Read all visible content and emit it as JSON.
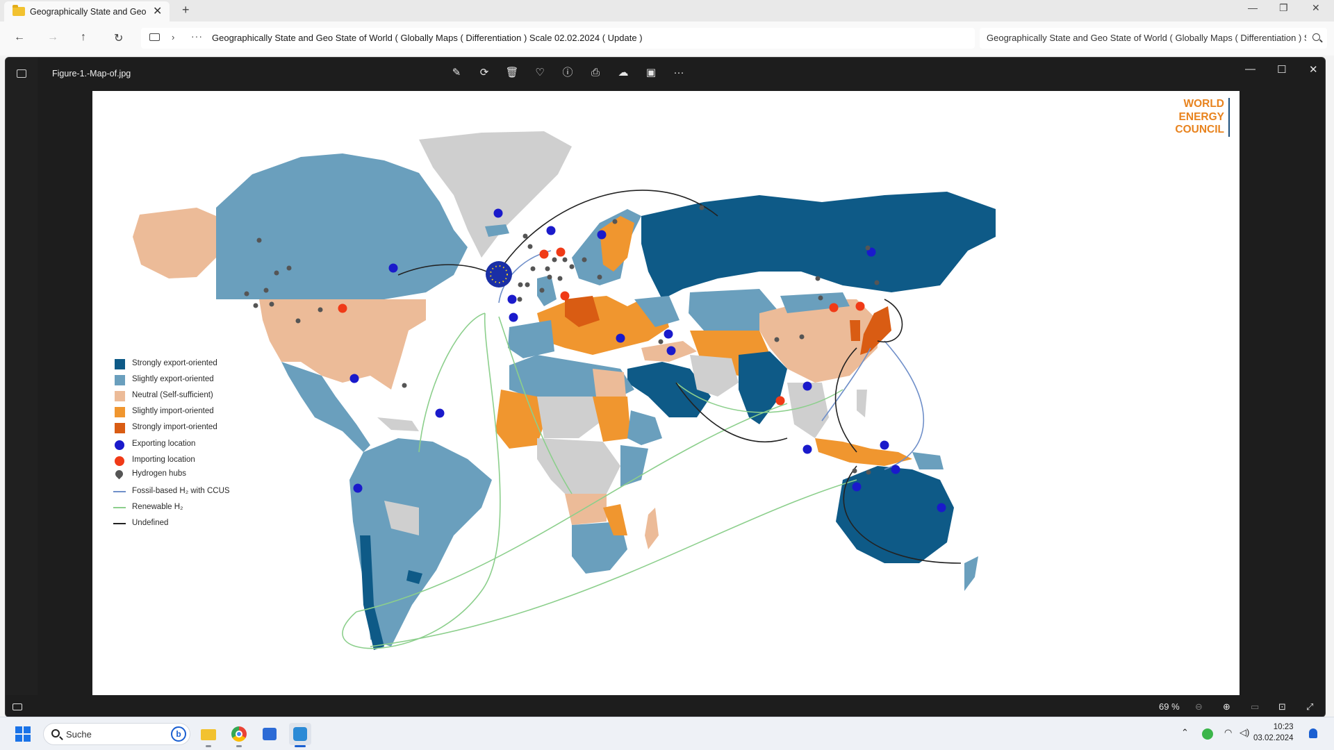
{
  "explorer": {
    "tab_title": "Geographically State and Geo",
    "tab_close": "✕",
    "new_tab": "+",
    "minimize": "—",
    "restore": "❐",
    "close": "✕",
    "nav": {
      "back": "←",
      "forward": "→",
      "up": "↑",
      "refresh": "↻",
      "more": "···",
      "chevron": "›"
    },
    "address_path": "Geographically State and Geo State of World ( Globally Maps ( Differentiation ) Scale 02.02.2024 ( Update )",
    "search_text": "Geographically State and Geo State of World ( Globally Maps ( Differentiation ) Scale 02.02.2024 ( Update )"
  },
  "viewer": {
    "file_name": "Figure-1.-Map-of.jpg",
    "toolbar": [
      {
        "icon": "edit-image-icon",
        "glyph": "✎"
      },
      {
        "icon": "rotate-icon",
        "glyph": "⟳"
      },
      {
        "icon": "delete-icon",
        "glyph": "🗑"
      },
      {
        "icon": "favorite-icon",
        "glyph": "♡"
      },
      {
        "icon": "info-icon",
        "glyph": "ⓘ"
      },
      {
        "icon": "print-icon",
        "glyph": "⎙"
      },
      {
        "icon": "onedrive-icon",
        "glyph": "☁"
      },
      {
        "icon": "clipchamp-icon",
        "glyph": "▣"
      },
      {
        "icon": "more-icon",
        "glyph": "···"
      }
    ],
    "minimize": "—",
    "maximize": "☐",
    "close": "✕",
    "zoom_level": "69 %",
    "status_icons": [
      "filmstrip-icon",
      "zoom-out-icon",
      "zoom-in-icon",
      "fit-icon",
      "actual-size-icon",
      "fullscreen-icon"
    ]
  },
  "map": {
    "brand_line1": "WORLD",
    "brand_line2": "ENERGY",
    "brand_line3": "COUNCIL",
    "colors": {
      "strong_export": "#0e5a87",
      "slight_export": "#6a9fbd",
      "neutral": "#ecbb98",
      "slight_import": "#f0962f",
      "strong_import": "#d95c13",
      "no_data": "#cfcfcf",
      "exporting": "#1a1acb",
      "importing": "#f03a17",
      "hub": "#555555",
      "fossil_line": "#6f8fc9",
      "renewable_line": "#8ccf8c",
      "undefined_line": "#222222"
    },
    "legend": [
      {
        "type": "swatch",
        "color": "#0e5a87",
        "label": "Strongly export-oriented"
      },
      {
        "type": "swatch",
        "color": "#6a9fbd",
        "label": "Slightly export-oriented"
      },
      {
        "type": "swatch",
        "color": "#ecbb98",
        "label": "Neutral (Self-sufficient)"
      },
      {
        "type": "swatch",
        "color": "#f0962f",
        "label": "Slightly import-oriented"
      },
      {
        "type": "swatch",
        "color": "#d95c13",
        "label": "Strongly import-oriented"
      },
      {
        "type": "dot",
        "color": "#1a1acb",
        "label": "Exporting location"
      },
      {
        "type": "dot",
        "color": "#f03a17",
        "label": "Importing location"
      },
      {
        "type": "pin",
        "color": "#555555",
        "label": "Hydrogen hubs"
      },
      {
        "type": "line",
        "color": "#6f8fc9",
        "label": "Fossil-based H₂ with CCUS"
      },
      {
        "type": "line",
        "color": "#8ccf8c",
        "label": "Renewable H₂"
      },
      {
        "type": "line",
        "color": "#222222",
        "label": "Undefined"
      }
    ]
  },
  "taskbar": {
    "search_label": "Suche",
    "bing": "b",
    "time": "10:23",
    "date": "03.02.2024",
    "apps": [
      "file-explorer-icon",
      "chrome-icon",
      "store-icon",
      "photos-icon"
    ]
  }
}
